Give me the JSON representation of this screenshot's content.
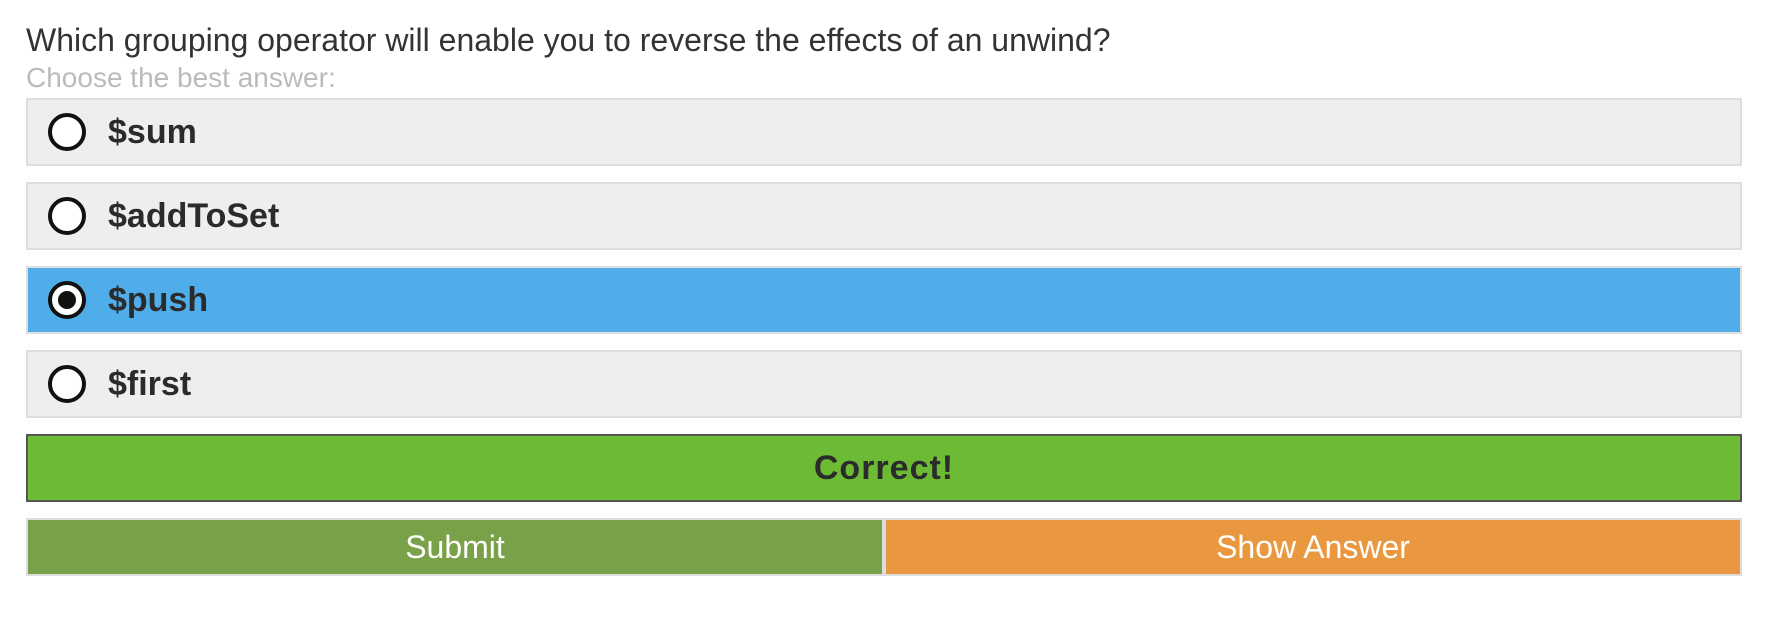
{
  "question": {
    "text": "Which grouping operator will enable you to reverse the effects of an unwind?",
    "instruction": "Choose the best answer:"
  },
  "options": [
    {
      "label": "$sum",
      "selected": false
    },
    {
      "label": "$addToSet",
      "selected": false
    },
    {
      "label": "$push",
      "selected": true
    },
    {
      "label": "$first",
      "selected": false
    }
  ],
  "feedback": {
    "text": "Correct!",
    "color": "#6dbb35"
  },
  "actions": {
    "submit_label": "Submit",
    "show_answer_label": "Show Answer"
  },
  "colors": {
    "selected_option": "#4fadea",
    "option_background": "#eeeeee",
    "submit_button": "#79a248",
    "show_answer_button": "#ea983f"
  }
}
